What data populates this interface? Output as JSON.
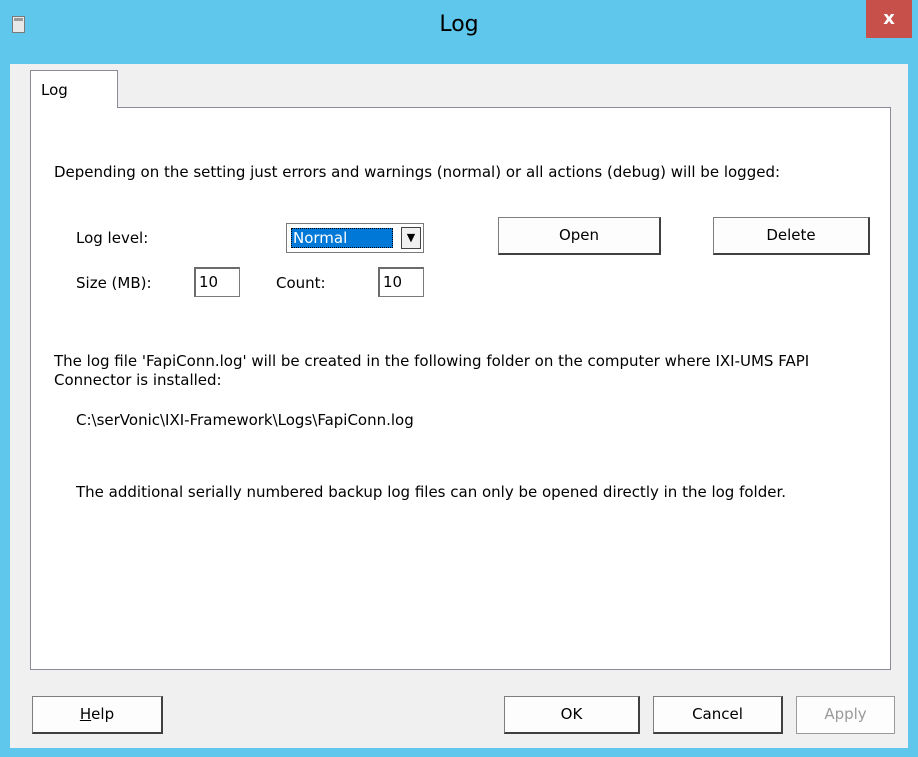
{
  "window": {
    "title": "Log",
    "close_label": "x"
  },
  "tabs": [
    {
      "label": "Log"
    }
  ],
  "panel": {
    "description": "Depending on the setting just errors and warnings (normal) or all actions (debug) will be logged:",
    "log_level_label": "Log level:",
    "log_level_value": "Normal",
    "open_label": "Open",
    "delete_label": "Delete",
    "size_label": "Size (MB):",
    "size_value": "10",
    "count_label": "Count:",
    "count_value": "10",
    "info_line1": "The log file 'FapiConn.log' will be created in the following folder on the computer where IXI-UMS FAPI Connector is installed:",
    "path": "C:\\serVonic\\IXI-Framework\\Logs\\FapiConn.log",
    "info_line2": "The additional serially numbered backup log files can only be opened directly in the log folder."
  },
  "footer": {
    "help_first": "H",
    "help_rest": "elp",
    "ok_label": "OK",
    "cancel_label": "Cancel",
    "apply_label": "Apply"
  },
  "colors": {
    "titlebar": "#5fc6ec",
    "close": "#c7504b",
    "selection": "#0078d7"
  }
}
